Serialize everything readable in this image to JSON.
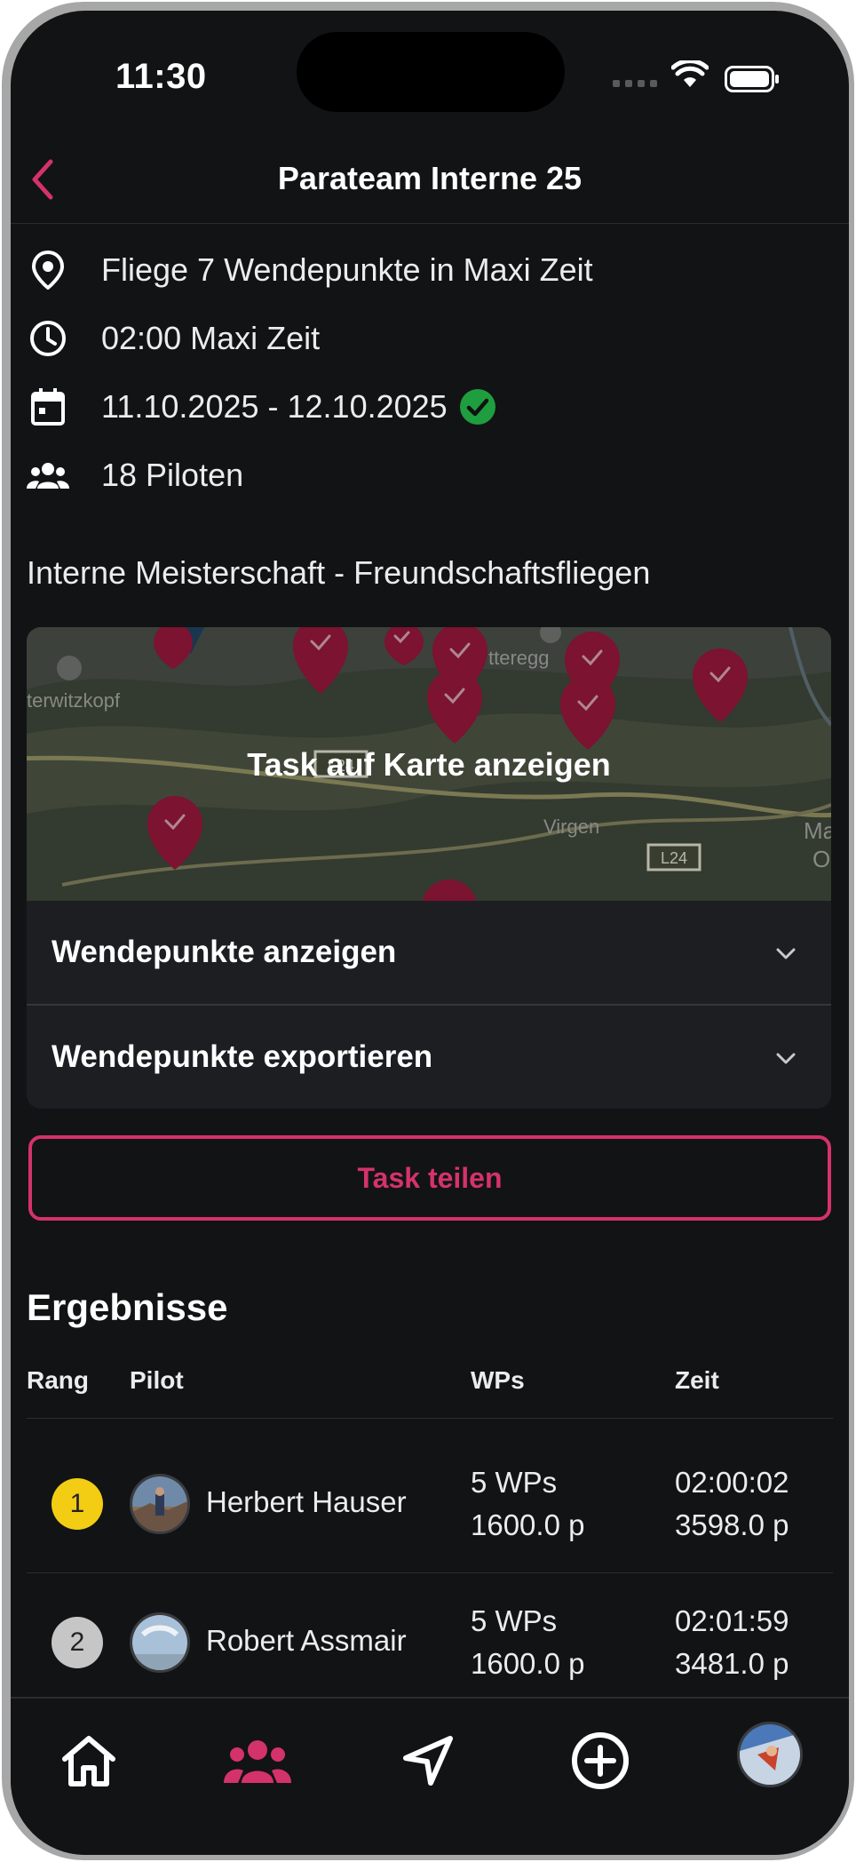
{
  "status": {
    "time": "11:30"
  },
  "nav": {
    "title": "Parateam Interne 25"
  },
  "info": {
    "task": "Fliege 7 Wendepunkte in Maxi Zeit",
    "duration": "02:00 Maxi Zeit",
    "dates": "11.10.2025 - 12.10.2025",
    "pilots": "18 Piloten"
  },
  "description": "Interne Meisterschaft - Freundschaftsfliegen",
  "map": {
    "label": "Task auf Karte anzeigen",
    "place_labels": [
      "terwitzkopf",
      "Virgen",
      "tteregg",
      "Ma",
      "Os"
    ],
    "road_labels": [
      "L24",
      "L24"
    ]
  },
  "accordion": {
    "show_waypoints": "Wendepunkte anzeigen",
    "export_waypoints": "Wendepunkte exportieren"
  },
  "share_button": "Task teilen",
  "results": {
    "title": "Ergebnisse",
    "columns": [
      "Rang",
      "Pilot",
      "WPs",
      "Zeit"
    ],
    "rows": [
      {
        "rank": "1",
        "name": "Herbert Hauser",
        "wps": "5 WPs",
        "wp_points": "1600.0 p",
        "time": "02:00:02",
        "time_points": "3598.0 p"
      },
      {
        "rank": "2",
        "name": "Robert Assmair",
        "wps": "5 WPs",
        "wp_points": "1600.0 p",
        "time": "02:01:59",
        "time_points": "3481.0 p"
      }
    ]
  },
  "colors": {
    "accent": "#d4326b",
    "background": "#121314",
    "card": "#1c1e22",
    "success": "#1e9e3e",
    "gold": "#f2cd14",
    "silver": "#c6c6c6"
  },
  "tabs": [
    "home-icon",
    "group-icon",
    "navigation-icon",
    "add-circle-icon",
    "profile-avatar"
  ]
}
